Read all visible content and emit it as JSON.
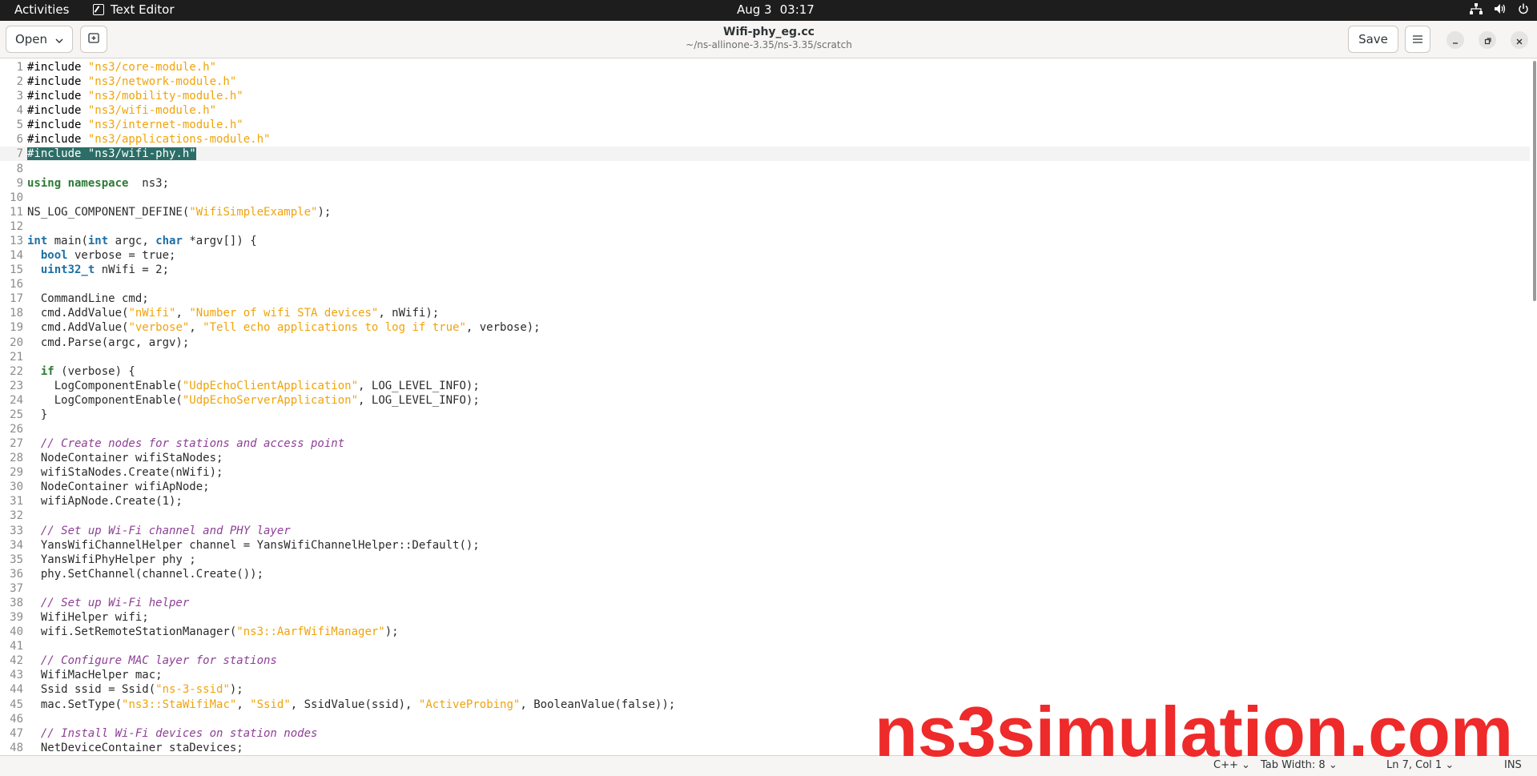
{
  "topbar": {
    "activities": "Activities",
    "app_name": "Text Editor",
    "date": "Aug 3",
    "time": "03:17"
  },
  "header": {
    "open_label": "Open",
    "save_label": "Save",
    "title": "Wifi-phy_eg.cc",
    "subtitle": "~/ns-allinone-3.35/ns-3.35/scratch"
  },
  "editor": {
    "current_line": 7,
    "lines": [
      {
        "n": "1",
        "segs": [
          [
            "pp",
            "#include "
          ],
          [
            "str",
            "\"ns3/core-module.h\""
          ]
        ]
      },
      {
        "n": "2",
        "segs": [
          [
            "pp",
            "#include "
          ],
          [
            "str",
            "\"ns3/network-module.h\""
          ]
        ]
      },
      {
        "n": "3",
        "segs": [
          [
            "pp",
            "#include "
          ],
          [
            "str",
            "\"ns3/mobility-module.h\""
          ]
        ]
      },
      {
        "n": "4",
        "segs": [
          [
            "pp",
            "#include "
          ],
          [
            "str",
            "\"ns3/wifi-module.h\""
          ]
        ]
      },
      {
        "n": "5",
        "segs": [
          [
            "pp",
            "#include "
          ],
          [
            "str",
            "\"ns3/internet-module.h\""
          ]
        ]
      },
      {
        "n": "6",
        "segs": [
          [
            "pp",
            "#include "
          ],
          [
            "str",
            "\"ns3/applications-module.h\""
          ]
        ]
      },
      {
        "n": "7",
        "segs": [
          [
            "sel",
            "#include \"ns3/wifi-phy.h\""
          ]
        ]
      },
      {
        "n": "8",
        "segs": []
      },
      {
        "n": "9",
        "segs": [
          [
            "kw",
            "using namespace"
          ],
          [
            "",
            "  ns3;"
          ]
        ]
      },
      {
        "n": "10",
        "segs": []
      },
      {
        "n": "11",
        "segs": [
          [
            "",
            "NS_LOG_COMPONENT_DEFINE("
          ],
          [
            "str",
            "\"WifiSimpleExample\""
          ],
          [
            "",
            ");"
          ]
        ]
      },
      {
        "n": "12",
        "segs": []
      },
      {
        "n": "13",
        "segs": [
          [
            "ty",
            "int"
          ],
          [
            "",
            " main("
          ],
          [
            "ty",
            "int"
          ],
          [
            "",
            " argc, "
          ],
          [
            "ty",
            "char"
          ],
          [
            "",
            " *argv[]) {"
          ]
        ]
      },
      {
        "n": "14",
        "segs": [
          [
            "",
            "  "
          ],
          [
            "ty",
            "bool"
          ],
          [
            "",
            " verbose = "
          ],
          [
            "",
            "true;"
          ]
        ]
      },
      {
        "n": "15",
        "segs": [
          [
            "",
            "  "
          ],
          [
            "ty",
            "uint32_t"
          ],
          [
            "",
            " nWifi = 2;"
          ]
        ]
      },
      {
        "n": "16",
        "segs": []
      },
      {
        "n": "17",
        "segs": [
          [
            "",
            "  CommandLine cmd;"
          ]
        ]
      },
      {
        "n": "18",
        "segs": [
          [
            "",
            "  cmd.AddValue("
          ],
          [
            "str",
            "\"nWifi\""
          ],
          [
            "",
            ", "
          ],
          [
            "str",
            "\"Number of wifi STA devices\""
          ],
          [
            "",
            ", nWifi);"
          ]
        ]
      },
      {
        "n": "19",
        "segs": [
          [
            "",
            "  cmd.AddValue("
          ],
          [
            "str",
            "\"verbose\""
          ],
          [
            "",
            ", "
          ],
          [
            "str",
            "\"Tell echo applications to log if true\""
          ],
          [
            "",
            ", verbose);"
          ]
        ]
      },
      {
        "n": "20",
        "segs": [
          [
            "",
            "  cmd.Parse(argc, argv);"
          ]
        ]
      },
      {
        "n": "21",
        "segs": []
      },
      {
        "n": "22",
        "segs": [
          [
            "",
            "  "
          ],
          [
            "kw",
            "if"
          ],
          [
            "",
            " (verbose) {"
          ]
        ]
      },
      {
        "n": "23",
        "segs": [
          [
            "",
            "    LogComponentEnable("
          ],
          [
            "str",
            "\"UdpEchoClientApplication\""
          ],
          [
            "",
            ", LOG_LEVEL_INFO);"
          ]
        ]
      },
      {
        "n": "24",
        "segs": [
          [
            "",
            "    LogComponentEnable("
          ],
          [
            "str",
            "\"UdpEchoServerApplication\""
          ],
          [
            "",
            ", LOG_LEVEL_INFO);"
          ]
        ]
      },
      {
        "n": "25",
        "segs": [
          [
            "",
            "  }"
          ]
        ]
      },
      {
        "n": "26",
        "segs": []
      },
      {
        "n": "27",
        "segs": [
          [
            "",
            "  "
          ],
          [
            "com",
            "// Create nodes for stations and access point"
          ]
        ]
      },
      {
        "n": "28",
        "segs": [
          [
            "",
            "  NodeContainer wifiStaNodes;"
          ]
        ]
      },
      {
        "n": "29",
        "segs": [
          [
            "",
            "  wifiStaNodes.Create(nWifi);"
          ]
        ]
      },
      {
        "n": "30",
        "segs": [
          [
            "",
            "  NodeContainer wifiApNode;"
          ]
        ]
      },
      {
        "n": "31",
        "segs": [
          [
            "",
            "  wifiApNode.Create(1);"
          ]
        ]
      },
      {
        "n": "32",
        "segs": []
      },
      {
        "n": "33",
        "segs": [
          [
            "",
            "  "
          ],
          [
            "com",
            "// Set up Wi-Fi channel and PHY layer"
          ]
        ]
      },
      {
        "n": "34",
        "segs": [
          [
            "",
            "  YansWifiChannelHelper channel = YansWifiChannelHelper::Default();"
          ]
        ]
      },
      {
        "n": "35",
        "segs": [
          [
            "",
            "  YansWifiPhyHelper phy ;"
          ]
        ]
      },
      {
        "n": "36",
        "segs": [
          [
            "",
            "  phy.SetChannel(channel.Create());"
          ]
        ]
      },
      {
        "n": "37",
        "segs": []
      },
      {
        "n": "38",
        "segs": [
          [
            "",
            "  "
          ],
          [
            "com",
            "// Set up Wi-Fi helper"
          ]
        ]
      },
      {
        "n": "39",
        "segs": [
          [
            "",
            "  WifiHelper wifi;"
          ]
        ]
      },
      {
        "n": "40",
        "segs": [
          [
            "",
            "  wifi.SetRemoteStationManager("
          ],
          [
            "str",
            "\"ns3::AarfWifiManager\""
          ],
          [
            "",
            ");"
          ]
        ]
      },
      {
        "n": "41",
        "segs": []
      },
      {
        "n": "42",
        "segs": [
          [
            "",
            "  "
          ],
          [
            "com",
            "// Configure MAC layer for stations"
          ]
        ]
      },
      {
        "n": "43",
        "segs": [
          [
            "",
            "  WifiMacHelper mac;"
          ]
        ]
      },
      {
        "n": "44",
        "segs": [
          [
            "",
            "  Ssid ssid = Ssid("
          ],
          [
            "str",
            "\"ns-3-ssid\""
          ],
          [
            "",
            ");"
          ]
        ]
      },
      {
        "n": "45",
        "segs": [
          [
            "",
            "  mac.SetType("
          ],
          [
            "str",
            "\"ns3::StaWifiMac\""
          ],
          [
            "",
            ", "
          ],
          [
            "str",
            "\"Ssid\""
          ],
          [
            "",
            ", SsidValue(ssid), "
          ],
          [
            "str",
            "\"ActiveProbing\""
          ],
          [
            "",
            ", BooleanValue("
          ],
          [
            "",
            "false));"
          ]
        ]
      },
      {
        "n": "46",
        "segs": []
      },
      {
        "n": "47",
        "segs": [
          [
            "",
            "  "
          ],
          [
            "com",
            "// Install Wi-Fi devices on station nodes"
          ]
        ]
      },
      {
        "n": "48",
        "segs": [
          [
            "",
            "  NetDeviceContainer staDevices;"
          ]
        ]
      }
    ]
  },
  "statusbar": {
    "language": "C++",
    "tab_width": "Tab Width: 8",
    "position": "Ln 7, Col 1",
    "mode": "INS"
  },
  "watermark": "ns3simulation.com",
  "colors": {
    "string": "#f0a30a",
    "keyword": "#2d7a36",
    "type": "#1d6fa5",
    "comment": "#8e3f96",
    "selection": "#2c6e67",
    "watermark": "#ee2a2a"
  },
  "icons": [
    "edit-icon",
    "network-icon",
    "volume-icon",
    "power-icon",
    "chevron-down-icon",
    "new-tab-icon",
    "hamburger-menu-icon",
    "minimize-icon",
    "maximize-icon",
    "close-icon"
  ]
}
